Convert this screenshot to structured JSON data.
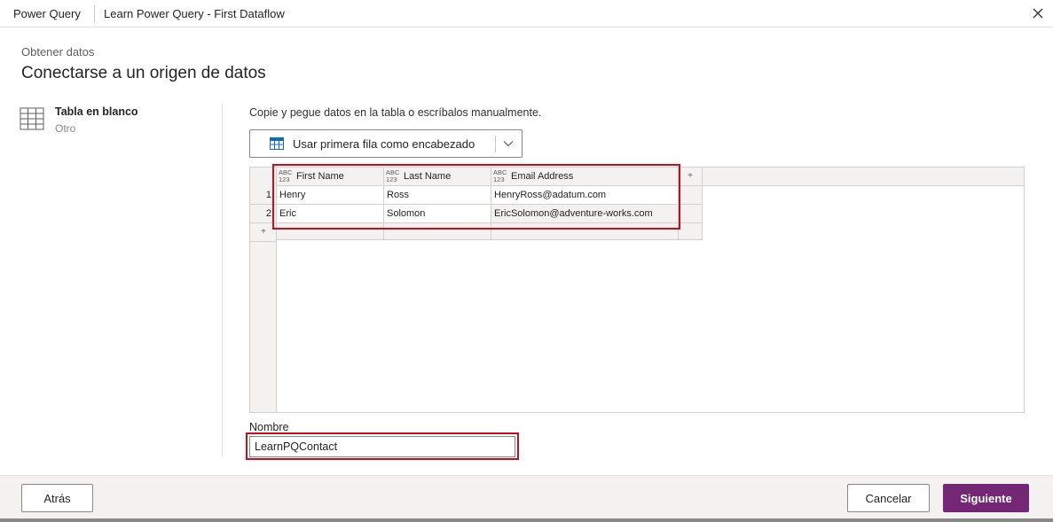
{
  "titlebar": {
    "app_name": "Power Query",
    "document_title": "Learn Power Query - First Dataflow"
  },
  "page": {
    "subtitle": "Obtener datos",
    "heading": "Conectarse a un origen de datos"
  },
  "source": {
    "name": "Tabla en blanco",
    "category": "Otro",
    "icon": "table-icon"
  },
  "editor": {
    "instructions": "Copie y pegue datos en la tabla o escríbalos manualmente.",
    "header_button_label": "Usar primera fila como encabezado",
    "type_badge_top": "ABC",
    "type_badge_bottom": "123",
    "add_symbol": "+",
    "columns": [
      {
        "name": "First Name"
      },
      {
        "name": "Last Name"
      },
      {
        "name": "Email Address"
      }
    ],
    "rows": [
      {
        "num": "1",
        "cells": [
          "Henry",
          "Ross",
          "HenryRoss@adatum.com"
        ]
      },
      {
        "num": "2",
        "cells": [
          "Eric",
          "Solomon",
          "EricSolomon@adventure-works.com"
        ]
      }
    ]
  },
  "name_field": {
    "label": "Nombre",
    "value": "LearnPQContact"
  },
  "footer": {
    "back_label": "Atrás",
    "cancel_label": "Cancelar",
    "next_label": "Siguiente"
  },
  "colors": {
    "primary": "#742774",
    "highlight": "#c50f1f"
  }
}
